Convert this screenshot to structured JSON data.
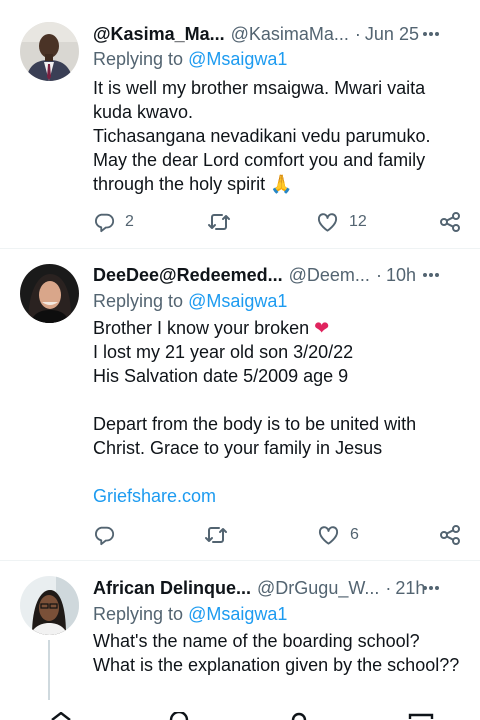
{
  "tweets": [
    {
      "name": "@Kasima_Ma...",
      "handle": "@KasimaMa...",
      "dot": "·",
      "time": "Jun 25",
      "replying_prefix": "Replying to",
      "replying_to": "@Msaigwa1",
      "lines": [
        "It is well my brother msaigwa. Mwari vaita",
        "kuda kwavo.",
        "Tichasangana nevadikani vedu parumuko.",
        "May the dear Lord comfort you and family",
        "through the holy spirit 🙏"
      ],
      "reply_count": "2",
      "retweet_count": "",
      "like_count": "12"
    },
    {
      "name": "DeeDee@Redeemed...",
      "handle": "@Deem...",
      "dot": "·",
      "time": "10h",
      "replying_prefix": "Replying to",
      "replying_to": "@Msaigwa1",
      "lines": [
        "Brother I know your broken ❤",
        "I lost my 21 year old son 3/20/22",
        "His Salvation date 5/2009 age 9",
        "",
        "Depart from the body is to be united with",
        "Christ. Grace to your family in Jesus",
        ""
      ],
      "link": "Griefshare.com",
      "reply_count": "",
      "retweet_count": "",
      "like_count": "6"
    },
    {
      "name": "African Delinque...",
      "handle": "@DrGugu_W...",
      "dot": "·",
      "time": "21h",
      "replying_prefix": "Replying to",
      "replying_to": "@Msaigwa1",
      "lines": [
        "What's the name of the boarding school?",
        "What is the explanation given by the school??"
      ]
    }
  ],
  "colors": {
    "text": "#0f1419",
    "secondary": "#536471",
    "link": "#1d9bf0",
    "divider": "#eff3f4",
    "heart_red": "#e0245e",
    "pray_yellow": "#f4b400"
  },
  "icons": [
    "avatar",
    "more-icon",
    "reply-icon",
    "retweet-icon",
    "like-icon",
    "share-icon"
  ]
}
